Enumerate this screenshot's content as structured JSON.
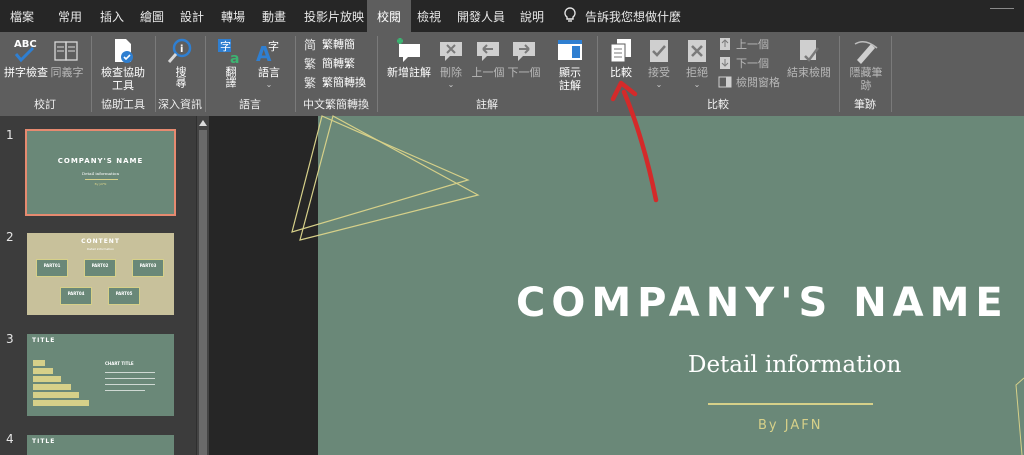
{
  "menu_tabs": [
    "檔案",
    "常用",
    "插入",
    "繪圖",
    "設計",
    "轉場",
    "動畫",
    "投影片放映",
    "校閱",
    "檢視",
    "開發人員",
    "說明"
  ],
  "active_tab": "校閱",
  "tell_me": "告訴我您想做什麼",
  "ribbon": {
    "proofing": {
      "spell": "拼字檢查",
      "thesaurus": "同義字",
      "label": "校訂"
    },
    "accessibility": {
      "check_line1": "檢查協助",
      "check_line2": "工具",
      "label": "協助工具"
    },
    "insights": {
      "search": "搜尋",
      "label": "深入資訊"
    },
    "language": {
      "translate": "翻譯",
      "language": "語言",
      "label": "語言"
    },
    "chinese": {
      "t2s": "繁轉簡",
      "s2t": "簡轉繁",
      "convert": "繁簡轉換",
      "label": "中文繁簡轉換"
    },
    "comments": {
      "new": "新增註解",
      "delete": "刪除",
      "previous": "上一個",
      "next": "下一個",
      "show_line1": "顯示",
      "show_line2": "註解",
      "label": "註解"
    },
    "compare": {
      "compare": "比較",
      "accept": "接受",
      "reject": "拒絕",
      "previous": "上一個",
      "next": "下一個",
      "reviewing_pane": "檢閱窗格",
      "end_review": "結束檢閱",
      "label": "比較"
    },
    "ink": {
      "hide_line1": "隱藏筆",
      "hide_line2": "跡",
      "label": "筆跡"
    }
  },
  "thumbnails": [
    {
      "number": "1",
      "title": "COMPANY'S NAME",
      "subtitle": "Detail information",
      "byline": "By JAFN"
    },
    {
      "number": "2",
      "title": "CONTENT",
      "subtitle": "Detail information",
      "parts": [
        "PART01",
        "PART02",
        "PART03",
        "PART04",
        "PART05"
      ]
    },
    {
      "number": "3",
      "title": "TITLE",
      "chart_title": "CHART TITLE"
    },
    {
      "number": "4",
      "title": "TITLE"
    }
  ],
  "slide": {
    "title": "COMPANY'S NAME",
    "detail": "Detail information",
    "byline": "By JAFN"
  },
  "colors": {
    "slide_bg": "#6a8878",
    "accent_line": "#d6d089",
    "annotation_arrow": "#d42a2a",
    "icon_blue": "#2f7fd1",
    "icon_green": "#3cb371"
  }
}
